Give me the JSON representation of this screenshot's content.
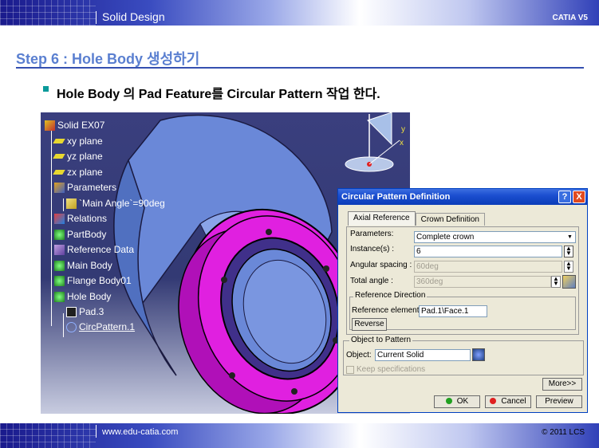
{
  "header": {
    "section": "Solid Design",
    "product": "CATIA V5"
  },
  "step": {
    "title": "Step 6 : Hole Body 생성하기",
    "bullet": "Hole Body 의 Pad Feature를 Circular Pattern 작업 한다."
  },
  "tree": {
    "items": [
      {
        "label": "Solid EX07"
      },
      {
        "label": "xy plane"
      },
      {
        "label": "yz plane"
      },
      {
        "label": "zx plane"
      },
      {
        "label": "Parameters"
      },
      {
        "label": "`Main Angle`=90deg"
      },
      {
        "label": "Relations"
      },
      {
        "label": "PartBody"
      },
      {
        "label": "Reference Data"
      },
      {
        "label": "Main Body"
      },
      {
        "label": "Flange Body01"
      },
      {
        "label": "Hole Body"
      },
      {
        "label": "Pad.3"
      },
      {
        "label": "CircPattern.1"
      }
    ]
  },
  "compass": {
    "y_label": "y",
    "x_label": "x"
  },
  "dialog": {
    "title": "Circular Pattern Definition",
    "help": "?",
    "close": "X",
    "tabs": [
      {
        "label": "Axial Reference"
      },
      {
        "label": "Crown Definition"
      }
    ],
    "parameters_label": "Parameters:",
    "parameters_value": "Complete crown",
    "instances_label": "Instance(s) :",
    "instances_value": "6",
    "angular_spacing_label": "Angular spacing :",
    "angular_spacing_value": "60deg",
    "total_angle_label": "Total angle :",
    "total_angle_value": "360deg",
    "ref_direction_group": "Reference Direction",
    "ref_element_label": "Reference element:",
    "ref_element_value": "Pad.1\\Face.1",
    "reverse_button": "Reverse",
    "object_group": "Object to Pattern",
    "object_label": "Object:",
    "object_value": "Current Solid",
    "keep_spec_label": "Keep specifications",
    "more_button": "More>>",
    "ok_button": "OK",
    "cancel_button": "Cancel",
    "preview_button": "Preview"
  },
  "footer": {
    "url": "www.edu-catia.com",
    "copyright": "© 2011 LCS"
  },
  "colors": {
    "accent_title": "#5a7fd0",
    "banner_dark": "#1a1a8c",
    "viewport_bg": "#363c78",
    "flange": "#e020e0",
    "body": "#6a88d8",
    "dialog_title": "#0a3cb8"
  }
}
